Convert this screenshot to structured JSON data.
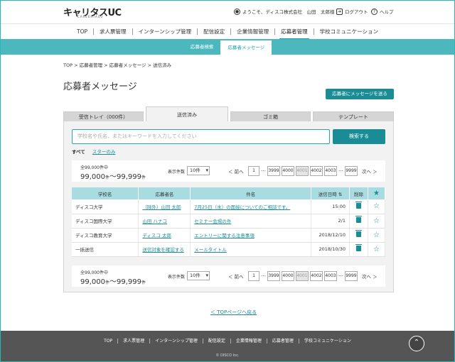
{
  "header": {
    "logo": "キャリタスUC",
    "logo_sub": "CAREERTASU",
    "greeting": "ようこそ、ディスコ株式会社　山田　太郎様",
    "logout": "ログアウト",
    "help": "ヘルプ"
  },
  "mainnav": [
    "TOP",
    "求人票管理",
    "インターンシップ管理",
    "配信設定",
    "企業情報管理",
    "応募者管理",
    "学校コミュニケーション"
  ],
  "mainnav_active": "応募者管理",
  "subnav": [
    "応募者検索",
    "応募者メッセージ"
  ],
  "breadcrumb": "TOP > 応募者管理 > 応募者メッセージ > 送信済み",
  "page_title": "応募者メッセージ",
  "send_button": "応募者にメッセージを送る",
  "tabs": [
    "受信トレイ（000件）",
    "送信済み",
    "ゴミ箱",
    "テンプレート"
  ],
  "search": {
    "placeholder": "学校名や氏名、またはキーワードを入力してください",
    "button": "検索する"
  },
  "filters": {
    "all": "すべて",
    "starred": "スターのみ"
  },
  "pager": {
    "total_label": "全99,000件中",
    "range_from": "99,000",
    "range_to": "99,999",
    "unit": "件",
    "tilde": "～",
    "per_page_label": "表示件数",
    "per_page_value": "10件",
    "prev": "＜ 前へ",
    "next": "次へ ＞",
    "pages": [
      "1",
      "3999",
      "4000",
      "4001",
      "4002",
      "4003",
      "9999"
    ],
    "current_page": "4001",
    "ellipsis": "…"
  },
  "table": {
    "headers": [
      "学校名",
      "応募者名",
      "件名",
      "送信日時",
      "削除"
    ],
    "rows": [
      {
        "school": "ディスコ大学",
        "name": "（除外）山田 太郎",
        "subject": "7月25日（水）の面接についてのご相談です。",
        "date": "15:00"
      },
      {
        "school": "ディスコ国際大学",
        "name": "山田 ハナコ",
        "subject": "セミナー会場の件",
        "date": "2/1"
      },
      {
        "school": "ディスコ教育大学",
        "name": "ディスコ 太郎",
        "subject": "エントリーに関する注意事項",
        "date": "2018/12/10"
      },
      {
        "school": "一括送信",
        "name": "送信対象を確認する",
        "subject": "メールタイトル",
        "date": "2018/10/30"
      }
    ]
  },
  "back_link": "＜ TOPページへ戻る",
  "footer": {
    "nav": [
      "TOP",
      "求人票管理",
      "インターンシップ管理",
      "配信設定",
      "企業情報管理",
      "応募者管理",
      "学校コミュニケーション"
    ],
    "copyright": "© DISCO Inc."
  }
}
